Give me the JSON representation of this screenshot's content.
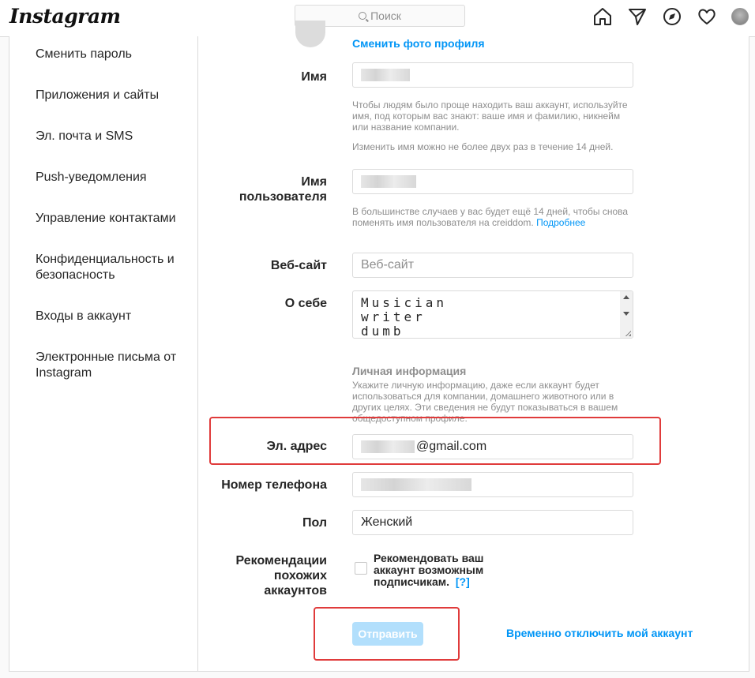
{
  "header": {
    "logo": "Instagram",
    "search_placeholder": "Поиск"
  },
  "sidebar": {
    "items": [
      {
        "label": "Сменить пароль"
      },
      {
        "label": "Приложения и сайты"
      },
      {
        "label": "Эл. почта и SMS"
      },
      {
        "label": "Push-уведомления"
      },
      {
        "label": "Управление контактами"
      },
      {
        "label": "Конфиденциальность и безопасность"
      },
      {
        "label": "Входы в аккаунт"
      },
      {
        "label": "Электронные письма от Instagram"
      }
    ]
  },
  "profile": {
    "change_photo": "Сменить фото профиля",
    "name_label": "Имя",
    "name_hint": "Чтобы людям было проще находить ваш аккаунт, используйте имя, под которым вас знают: ваше имя и фамилию, никнейм или название компании.",
    "name_limit": "Изменить имя можно не более двух раз в течение 14 дней.",
    "username_label": "Имя пользователя",
    "username_hint": "В большинстве случаев у вас будет ещё 14 дней, чтобы снова поменять имя пользователя на creiddom.",
    "username_more": "Подробнее",
    "website_label": "Веб-сайт",
    "website_placeholder": "Веб-сайт",
    "bio_label": "О себе",
    "bio_lines": [
      "Musician",
      "writer",
      "dumb"
    ],
    "personal_title": "Личная информация",
    "personal_hint": "Укажите личную информацию, даже если аккаунт будет использоваться для компании, домашнего животного или в других целях. Эти сведения не будут показываться в вашем общедоступном профиле.",
    "email_label": "Эл. адрес",
    "email_suffix": "@gmail.com",
    "phone_label": "Номер телефона",
    "gender_label": "Пол",
    "gender_value": "Женский",
    "suggest_label": "Рекомендации похожих аккаунтов",
    "suggest_text": "Рекомендовать ваш аккаунт возможным подписчикам.",
    "suggest_help": "[?]",
    "submit": "Отправить",
    "disable": "Временно отключить мой аккаунт"
  },
  "colors": {
    "accent": "#0095f6",
    "highlight": "#e03b3b"
  }
}
